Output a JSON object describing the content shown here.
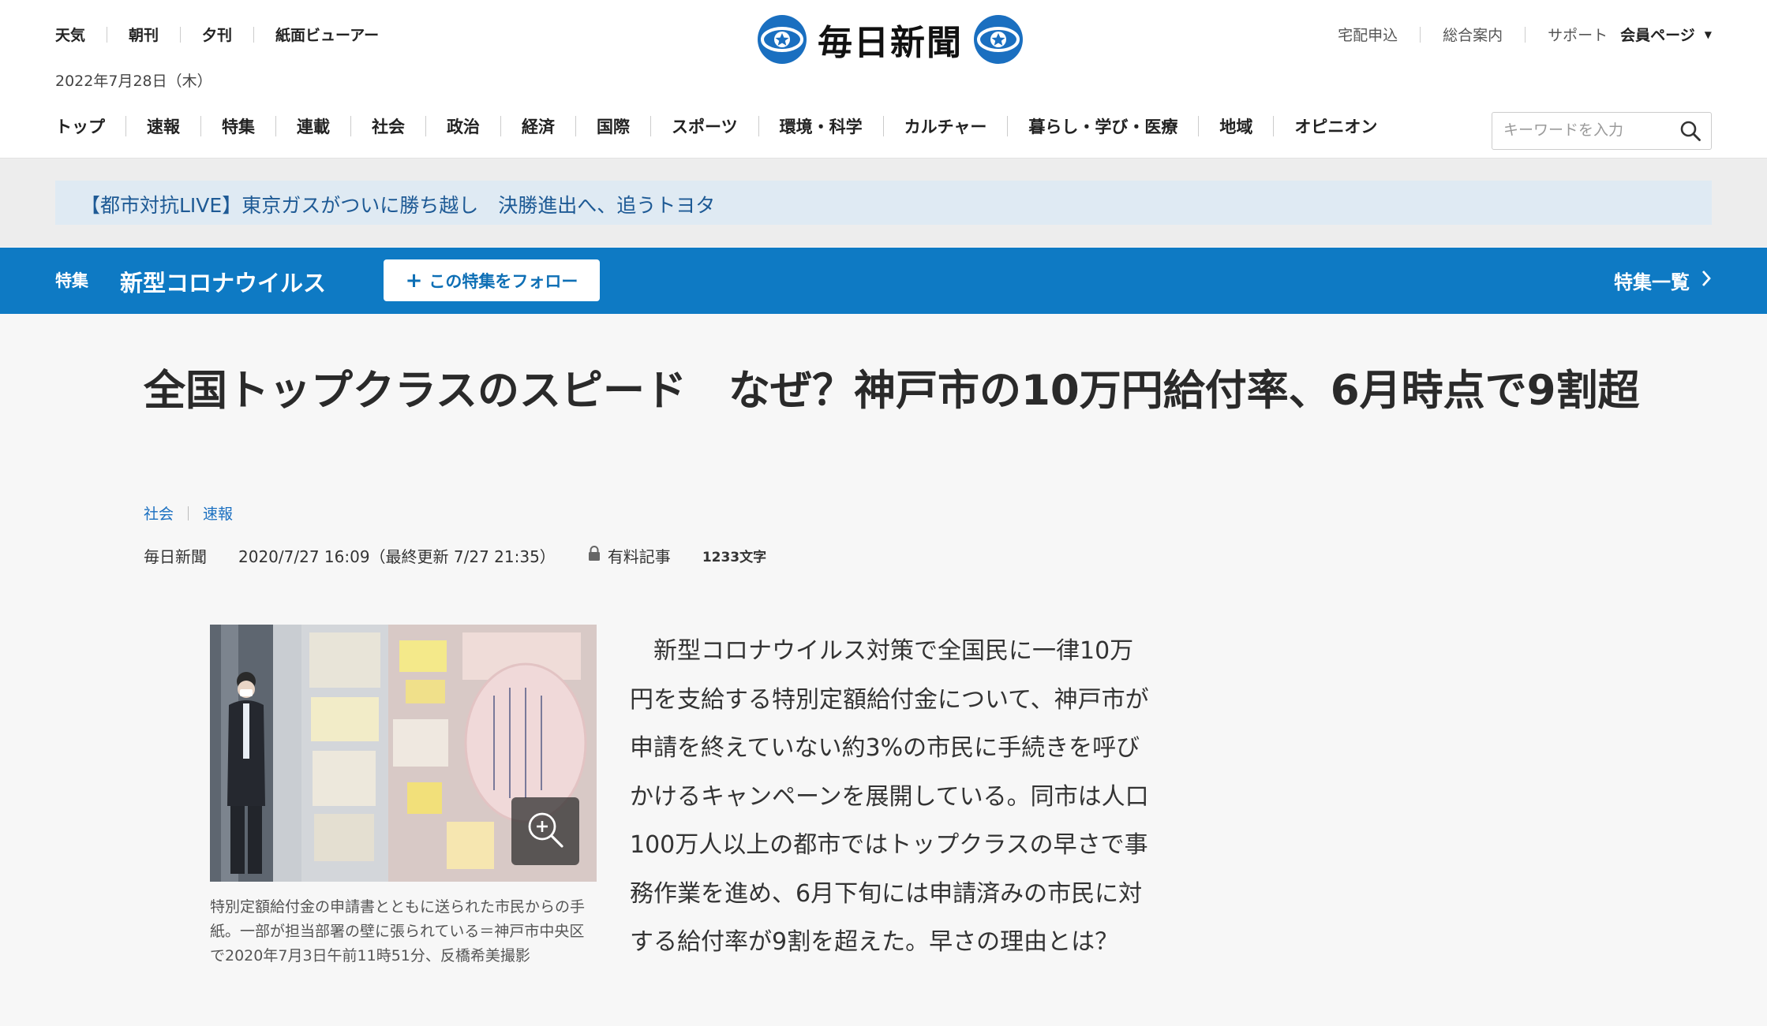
{
  "header": {
    "util_nav": [
      "天気",
      "朝刊",
      "夕刊",
      "紙面ビューアー"
    ],
    "date": "2022年7月28日（木）",
    "logo_text": "毎日新聞",
    "right_links": [
      "宅配申込",
      "総合案内",
      "サポート"
    ],
    "member_label": "会員ページ",
    "main_nav": [
      "トップ",
      "速報",
      "特集",
      "連載",
      "社会",
      "政治",
      "経済",
      "国際",
      "スポーツ",
      "環境・科学",
      "カルチャー",
      "暮らし・学び・医療",
      "地域",
      "オピニオン"
    ],
    "search_placeholder": "キーワードを入力"
  },
  "breaking": {
    "text": "【都市対抗LIVE】東京ガスがついに勝ち越し　決勝進出へ、追うトヨタ"
  },
  "feature_bar": {
    "label": "特集",
    "title": "新型コロナウイルス",
    "follow_label": "この特集をフォロー",
    "list_label": "特集一覧"
  },
  "article": {
    "headline": "全国トップクラスのスピード　なぜ？神戸市の10万円給付率、6月時点で9割超",
    "categories": [
      "社会",
      "速報"
    ],
    "source": "毎日新聞",
    "datetime": "2020/7/27 16:09（最終更新 7/27 21:35）",
    "paid_label": "有料記事",
    "char_count": "1233文字",
    "photo_caption": "特別定額給付金の申請書とともに送られた市民からの手紙。一部が担当部署の壁に張られている＝神戸市中央区で2020年7月3日午前11時51分、反橋希美撮影",
    "body": "　新型コロナウイルス対策で全国民に一律10万円を支給する特別定額給付金について、神戸市が申請を終えていない約3%の市民に手続きを呼びかけるキャンペーンを展開している。同市は人口100万人以上の都市ではトップクラスの早さで事務作業を進め、6月下旬には申請済みの市民に対する給付率が9割を超えた。早さの理由とは？"
  },
  "colors": {
    "brand_blue": "#0e7ac4",
    "breaking_bg": "#dfeaf3",
    "link_blue": "#1a6fc0"
  }
}
